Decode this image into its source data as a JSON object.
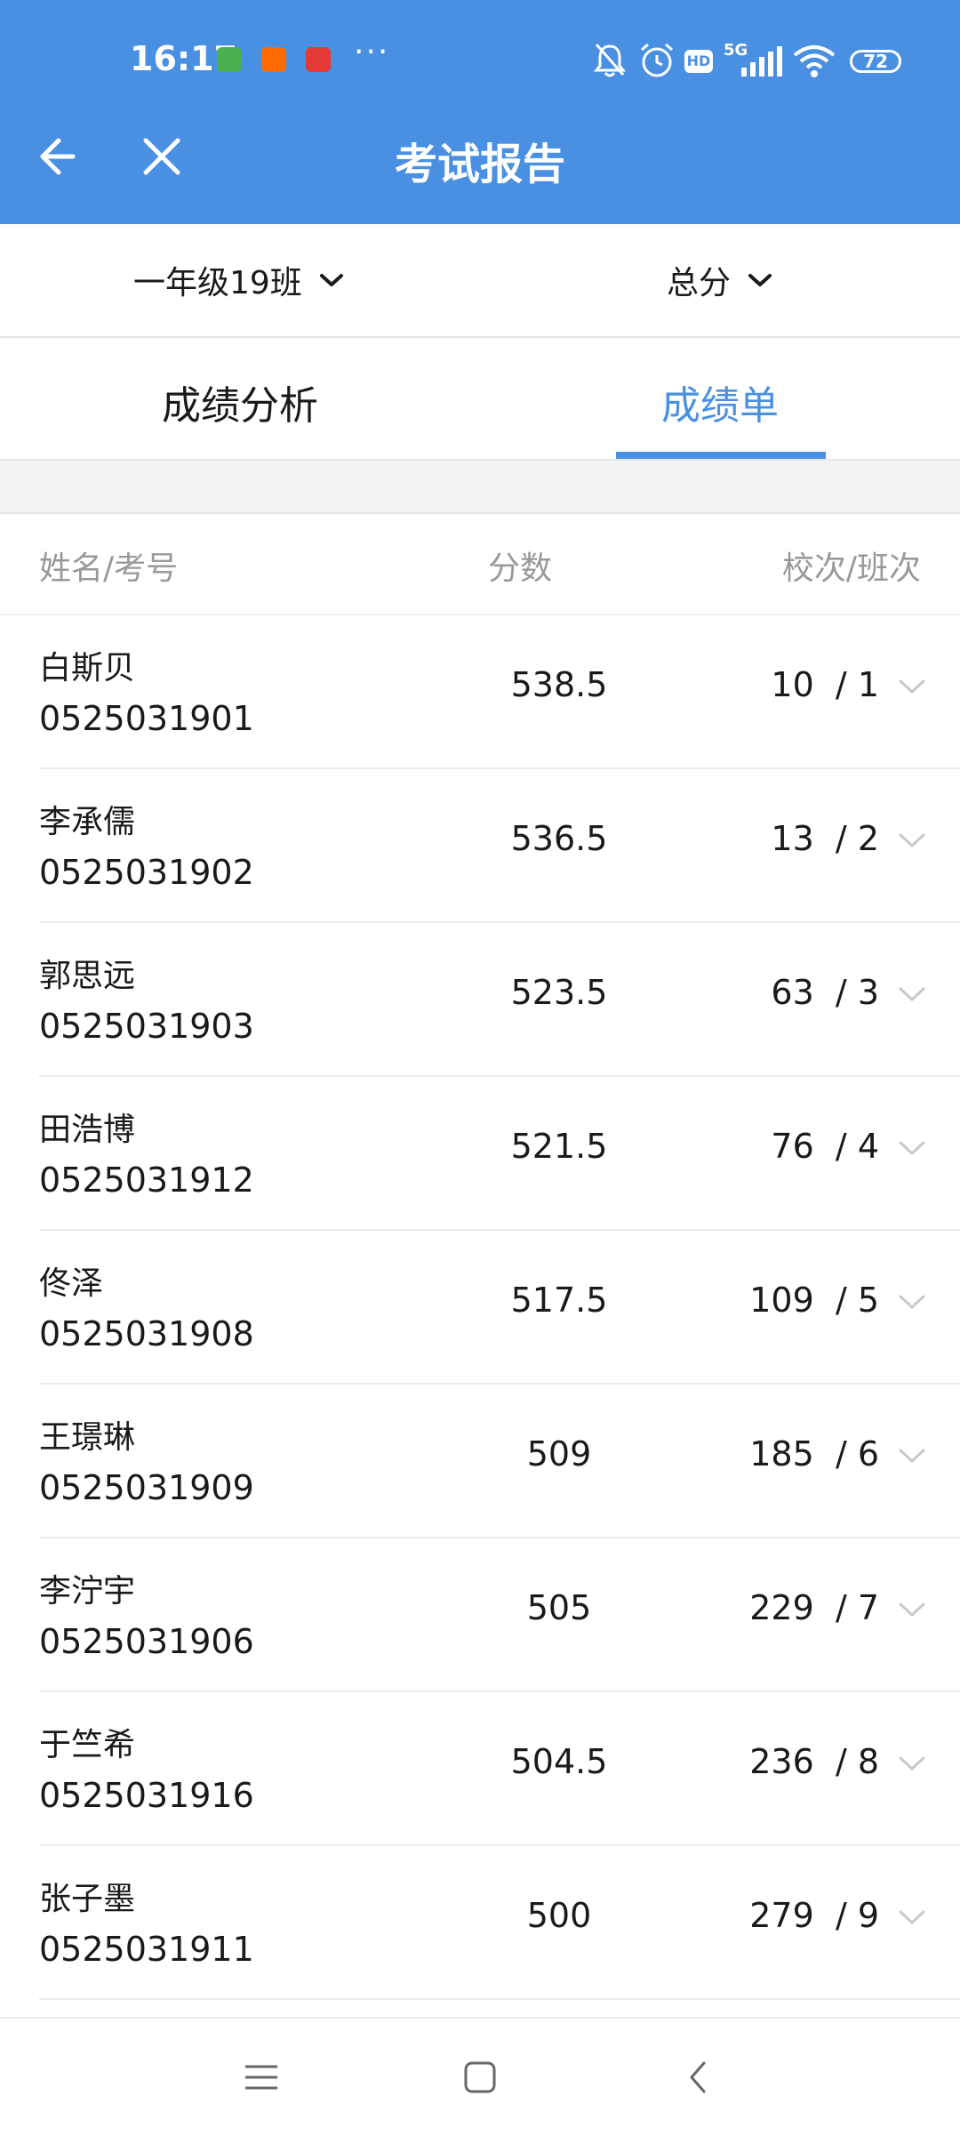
{
  "status_bar": {
    "time": "16:17",
    "network": "5G",
    "hd": "HD",
    "battery": "72",
    "more": "···"
  },
  "header": {
    "title": "考试报告",
    "back_icon": "arrow-left-icon",
    "close_icon": "close-icon"
  },
  "filters": {
    "class_label": "一年级19班",
    "subject_label": "总分"
  },
  "tabs": [
    {
      "label": "成绩分析",
      "active": false
    },
    {
      "label": "成绩单",
      "active": true
    }
  ],
  "table": {
    "headers": {
      "name": "姓名/考号",
      "score": "分数",
      "rank": "校次/班次"
    },
    "rows": [
      {
        "name": "白斯贝",
        "id": "0525031901",
        "score": "538.5",
        "rank": "10  / 1"
      },
      {
        "name": "李承儒",
        "id": "0525031902",
        "score": "536.5",
        "rank": "13  / 2"
      },
      {
        "name": "郭思远",
        "id": "0525031903",
        "score": "523.5",
        "rank": "63  / 3"
      },
      {
        "name": "田浩博",
        "id": "0525031912",
        "score": "521.5",
        "rank": "76  / 4"
      },
      {
        "name": "佟泽",
        "id": "0525031908",
        "score": "517.5",
        "rank": "109  / 5"
      },
      {
        "name": "王璟琳",
        "id": "0525031909",
        "score": "509",
        "rank": "185  / 6"
      },
      {
        "name": "李泞宇",
        "id": "0525031906",
        "score": "505",
        "rank": "229  / 7"
      },
      {
        "name": "于竺希",
        "id": "0525031916",
        "score": "504.5",
        "rank": "236  / 8"
      },
      {
        "name": "张子墨",
        "id": "0525031911",
        "score": "500",
        "rank": "279  / 9"
      }
    ]
  },
  "colors": {
    "accent": "#4a90e2",
    "muted": "#999999"
  }
}
